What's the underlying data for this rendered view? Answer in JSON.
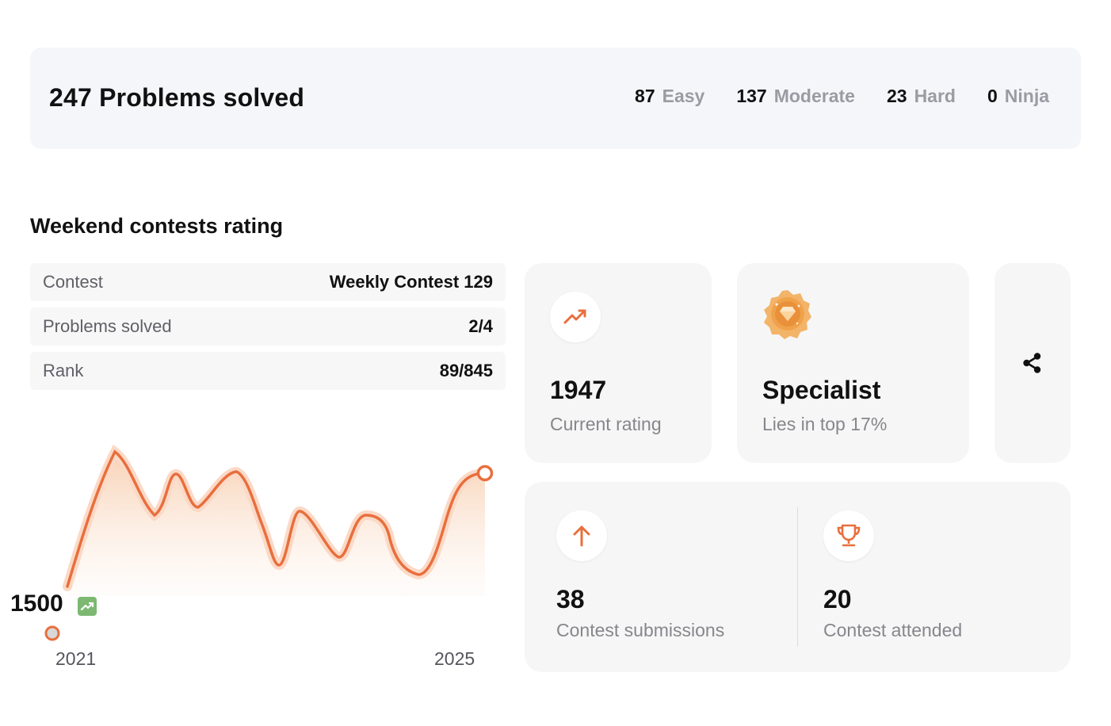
{
  "summary": {
    "title": "247 Problems solved",
    "difficulties": [
      {
        "count": "87",
        "label": "Easy"
      },
      {
        "count": "137",
        "label": "Moderate"
      },
      {
        "count": "23",
        "label": "Hard"
      },
      {
        "count": "0",
        "label": "Ninja"
      }
    ]
  },
  "contests": {
    "title": "Weekend contests rating",
    "rows": [
      {
        "label": "Contest",
        "value": "Weekly Contest 129"
      },
      {
        "label": "Problems solved",
        "value": "2/4"
      },
      {
        "label": "Rank",
        "value": "89/845"
      }
    ]
  },
  "chart_data": {
    "type": "area",
    "start_value": "1500",
    "x_labels": [
      "2021",
      "2025"
    ],
    "series_color": "#e86f3d",
    "trend_icon": "trending-up-icon"
  },
  "rating_card": {
    "value": "1947",
    "label": "Current rating",
    "icon": "trending-up-icon"
  },
  "badge_card": {
    "value": "Specialist",
    "label": "Lies in top 17%",
    "icon": "specialist-badge-icon"
  },
  "share_card": {
    "icon": "share-icon"
  },
  "activity_card": {
    "submissions": {
      "value": "38",
      "label": "Contest submissions",
      "icon": "arrow-up-icon"
    },
    "attended": {
      "value": "20",
      "label": "Contest attended",
      "icon": "trophy-icon"
    }
  },
  "colors": {
    "accent": "#e86f3d",
    "panel": "#f6f6f6",
    "summary_bg": "#f5f6fa",
    "muted": "#9b9ba3"
  }
}
